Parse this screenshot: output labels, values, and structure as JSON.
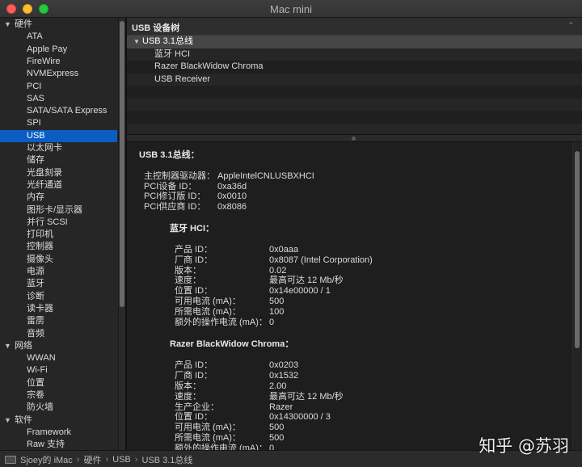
{
  "window": {
    "title": "Mac mini"
  },
  "sidebar": {
    "rows": [
      {
        "type": "head",
        "label": "硬件",
        "arrow": "▼"
      },
      {
        "type": "item",
        "label": "ATA"
      },
      {
        "type": "item",
        "label": "Apple Pay"
      },
      {
        "type": "item",
        "label": "FireWire"
      },
      {
        "type": "item",
        "label": "NVMExpress"
      },
      {
        "type": "item",
        "label": "PCI"
      },
      {
        "type": "item",
        "label": "SAS"
      },
      {
        "type": "item",
        "label": "SATA/SATA Express"
      },
      {
        "type": "item",
        "label": "SPI"
      },
      {
        "type": "item",
        "label": "USB",
        "selected": true
      },
      {
        "type": "item",
        "label": "以太网卡"
      },
      {
        "type": "item",
        "label": "储存"
      },
      {
        "type": "item",
        "label": "光盘刻录"
      },
      {
        "type": "item",
        "label": "光纤通道"
      },
      {
        "type": "item",
        "label": "内存"
      },
      {
        "type": "item",
        "label": "图形卡/显示器"
      },
      {
        "type": "item",
        "label": "并行 SCSI"
      },
      {
        "type": "item",
        "label": "打印机"
      },
      {
        "type": "item",
        "label": "控制器"
      },
      {
        "type": "item",
        "label": "摄像头"
      },
      {
        "type": "item",
        "label": "电源"
      },
      {
        "type": "item",
        "label": "蓝牙"
      },
      {
        "type": "item",
        "label": "诊断"
      },
      {
        "type": "item",
        "label": "读卡器"
      },
      {
        "type": "item",
        "label": "雷雳"
      },
      {
        "type": "item",
        "label": "音频"
      },
      {
        "type": "head",
        "label": "网络",
        "arrow": "▼"
      },
      {
        "type": "item",
        "label": "WWAN"
      },
      {
        "type": "item",
        "label": "Wi-Fi"
      },
      {
        "type": "item",
        "label": "位置"
      },
      {
        "type": "item",
        "label": "宗卷"
      },
      {
        "type": "item",
        "label": "防火墙"
      },
      {
        "type": "head",
        "label": "软件",
        "arrow": "▼"
      },
      {
        "type": "item",
        "label": "Framework"
      },
      {
        "type": "item",
        "label": "Raw 支持"
      }
    ]
  },
  "tree": {
    "header": "USB 设备树",
    "collapse_chevron": "⌃",
    "rows": [
      {
        "label": "USB 3.1总线",
        "level": 1,
        "triangle": "▼",
        "selected": true
      },
      {
        "label": "蓝牙 HCI",
        "level": 2
      },
      {
        "label": "Razer BlackWidow Chroma",
        "level": 2
      },
      {
        "label": "USB Receiver",
        "level": 2
      },
      {
        "label": "",
        "level": 0
      },
      {
        "label": "",
        "level": 0
      },
      {
        "label": "",
        "level": 0
      },
      {
        "label": "",
        "level": 0
      }
    ]
  },
  "detail": {
    "bus_title": "USB 3.1总线：",
    "bus_props": [
      {
        "k": "主控制器驱动器：",
        "v": "AppleIntelCNLUSBXHCI"
      },
      {
        "k": "PCI设备 ID：",
        "v": "0xa36d"
      },
      {
        "k": "PCI修订版 ID：",
        "v": "0x0010"
      },
      {
        "k": "PCI供应商 ID：",
        "v": "0x8086"
      }
    ],
    "devices": [
      {
        "title": "蓝牙 HCI：",
        "props": [
          {
            "k": "产品 ID：",
            "v": "0x0aaa"
          },
          {
            "k": "厂商 ID：",
            "v": "0x8087  (Intel Corporation)"
          },
          {
            "k": "版本：",
            "v": "0.02"
          },
          {
            "k": "速度：",
            "v": "最高可达 12 Mb/秒"
          },
          {
            "k": "位置 ID：",
            "v": "0x14e00000 / 1"
          },
          {
            "k": "可用电流 (mA)：",
            "v": "500"
          },
          {
            "k": "所需电流 (mA)：",
            "v": "100"
          },
          {
            "k": "额外的操作电流 (mA)：",
            "v": "0"
          }
        ]
      },
      {
        "title": "Razer BlackWidow Chroma：",
        "props": [
          {
            "k": "产品 ID：",
            "v": "0x0203"
          },
          {
            "k": "厂商 ID：",
            "v": "0x1532"
          },
          {
            "k": "版本：",
            "v": "2.00"
          },
          {
            "k": "速度：",
            "v": "最高可达 12 Mb/秒"
          },
          {
            "k": "生产企业：",
            "v": "Razer"
          },
          {
            "k": "位置 ID：",
            "v": "0x14300000 / 3"
          },
          {
            "k": "可用电流 (mA)：",
            "v": "500"
          },
          {
            "k": "所需电流 (mA)：",
            "v": "500"
          },
          {
            "k": "额外的操作电流 (mA)：",
            "v": "0"
          }
        ]
      }
    ]
  },
  "statusbar": {
    "path": [
      "Sjoey的 iMac",
      "硬件",
      "USB",
      "USB 3.1总线"
    ],
    "separator": "›"
  },
  "watermark": {
    "text": "知乎 @苏羽"
  },
  "colors": {
    "selection": "#0a5dc2",
    "background": "#1e1e1e"
  }
}
